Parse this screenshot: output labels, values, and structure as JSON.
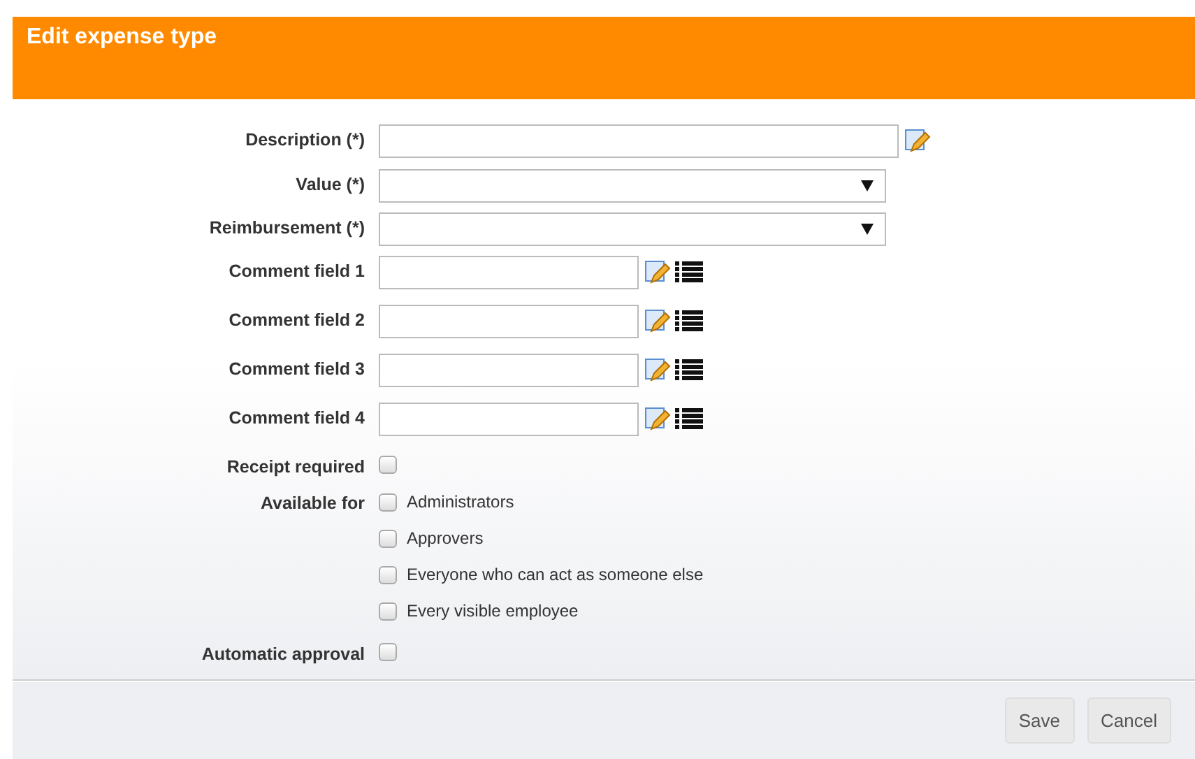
{
  "header": {
    "title": "Edit expense type"
  },
  "fields": [
    {
      "kind": "text",
      "label": "Description (*)"
    },
    {
      "kind": "select",
      "label": "Value (*)"
    },
    {
      "kind": "select",
      "label": "Reimbursement (*)"
    },
    {
      "kind": "comment",
      "label": "Comment field 1"
    },
    {
      "kind": "comment",
      "label": "Comment field 2"
    },
    {
      "kind": "comment",
      "label": "Comment field 3"
    },
    {
      "kind": "comment",
      "label": "Comment field 4"
    },
    {
      "kind": "checkbox",
      "label": "Receipt required",
      "checked": false
    },
    {
      "kind": "checkgroup",
      "label": "Available for",
      "options": [
        {
          "label": "Administrators",
          "checked": false
        },
        {
          "label": "Approvers",
          "checked": false
        },
        {
          "label": "Everyone who can act as someone else",
          "checked": false
        },
        {
          "label": "Every visible employee",
          "checked": false
        }
      ]
    },
    {
      "kind": "checkbox",
      "label": "Automatic approval",
      "checked": false
    }
  ],
  "buttons": [
    "Save",
    "Cancel"
  ]
}
